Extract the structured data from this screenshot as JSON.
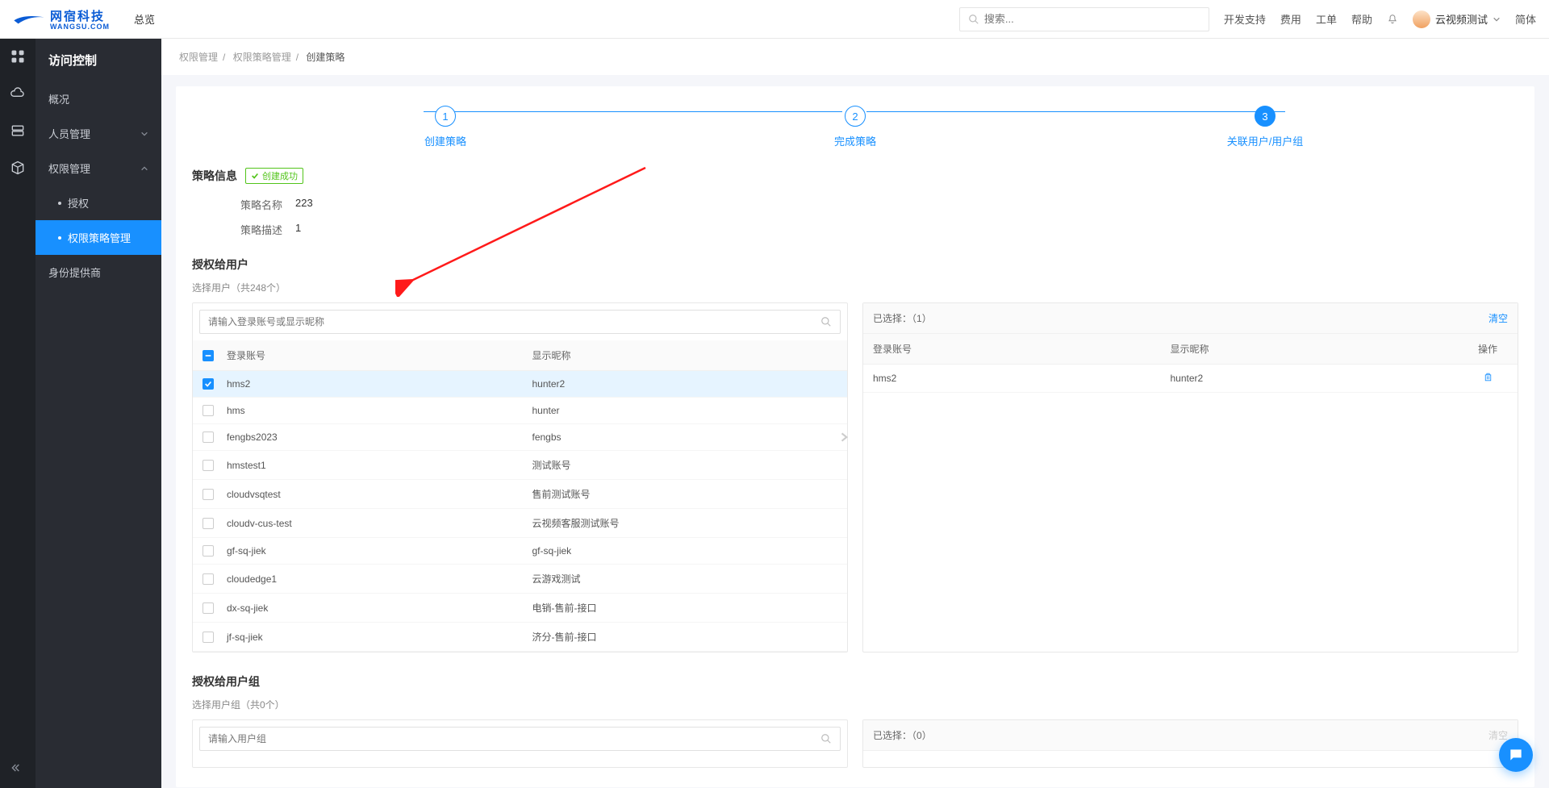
{
  "header": {
    "brand_main": "网宿科技",
    "brand_sub": "WANGSU.COM",
    "overview": "总览",
    "search_placeholder": "搜索...",
    "links": {
      "dev": "开发支持",
      "fee": "费用",
      "ticket": "工单",
      "help": "帮助"
    },
    "user_name": "云视频测试",
    "lang": "简体"
  },
  "sidebar": {
    "title": "访问控制",
    "overview": "概况",
    "people": "人员管理",
    "perm": "权限管理",
    "perm_auth": "授权",
    "perm_policy": "权限策略管理",
    "idp": "身份提供商"
  },
  "breadcrumb": {
    "a": "权限管理",
    "b": "权限策略管理",
    "c": "创建策略"
  },
  "steps": {
    "s1": "创建策略",
    "s2": "完成策略",
    "s3": "关联用户/用户组",
    "n1": "1",
    "n2": "2",
    "n3": "3"
  },
  "policy": {
    "section": "策略信息",
    "badge": "创建成功",
    "name_label": "策略名称",
    "name_value": "223",
    "desc_label": "策略描述",
    "desc_value": "1"
  },
  "users": {
    "section": "授权给用户",
    "note": "选择用户（共248个）",
    "search_placeholder": "请输入登录账号或显示昵称",
    "col_account": "登录账号",
    "col_nick": "显示昵称",
    "col_op": "操作",
    "selected_label": "已选择：",
    "selected_count": "（1）",
    "clear": "清空",
    "list": [
      {
        "acc": "hms2",
        "nick": "hunter2",
        "checked": true
      },
      {
        "acc": "hms",
        "nick": "hunter",
        "checked": false
      },
      {
        "acc": "fengbs2023",
        "nick": "fengbs",
        "checked": false
      },
      {
        "acc": "hmstest1",
        "nick": "测试账号",
        "checked": false
      },
      {
        "acc": "cloudvsqtest",
        "nick": "售前测试账号",
        "checked": false
      },
      {
        "acc": "cloudv-cus-test",
        "nick": "云视频客服测试账号",
        "checked": false
      },
      {
        "acc": "gf-sq-jiek",
        "nick": "gf-sq-jiek",
        "checked": false
      },
      {
        "acc": "cloudedge1",
        "nick": "云游戏测试",
        "checked": false
      },
      {
        "acc": "dx-sq-jiek",
        "nick": "电销-售前-接口",
        "checked": false
      },
      {
        "acc": "jf-sq-jiek",
        "nick": "济分-售前-接口",
        "checked": false
      }
    ],
    "chosen": [
      {
        "acc": "hms2",
        "nick": "hunter2"
      }
    ]
  },
  "groups": {
    "section": "授权给用户组",
    "note": "选择用户组（共0个）",
    "search_placeholder": "请输入用户组",
    "selected_label": "已选择：",
    "selected_count": "（0）",
    "clear": "清空"
  }
}
